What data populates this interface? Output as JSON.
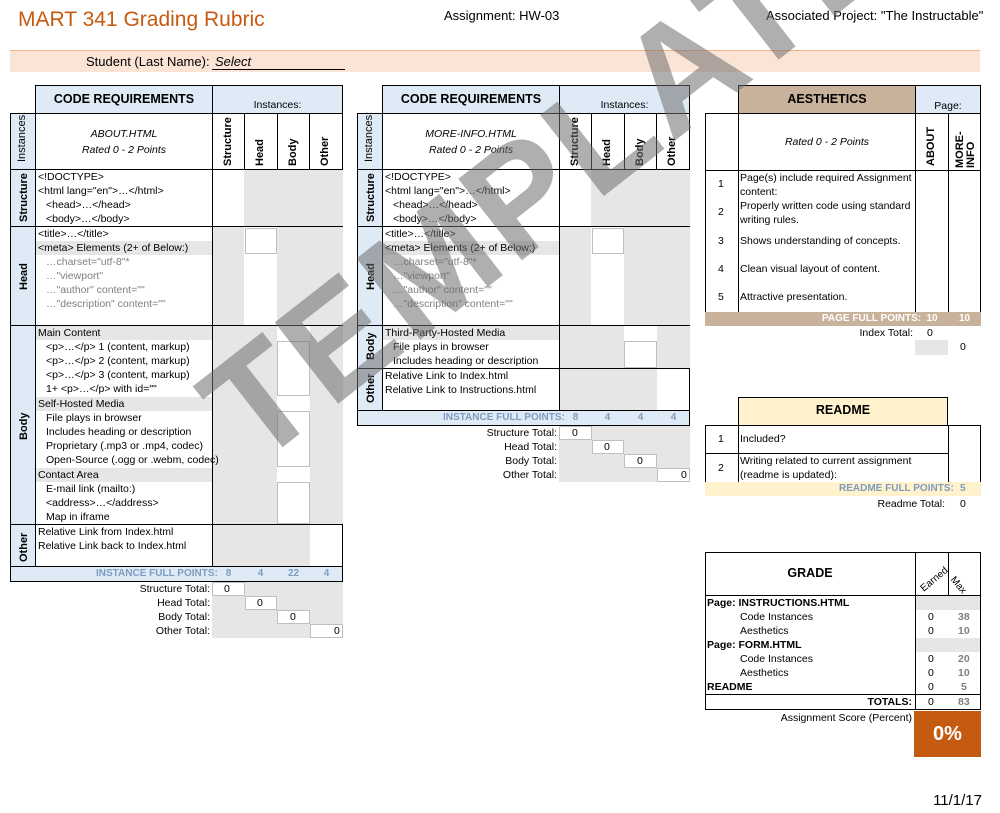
{
  "header": {
    "title": "MART 341 Grading Rubric",
    "assignment": "Assignment: HW-03",
    "project": "Associated Project: \"The Instructable\""
  },
  "student": {
    "label": "Student (Last Name):",
    "value": "Select"
  },
  "watermark": "TEMPLATE",
  "date": "11/1/17",
  "left_table": {
    "heading": "CODE REQUIREMENTS",
    "instances_label": "Instances:",
    "side_label": "Instances:",
    "file": "ABOUT.HTML",
    "rated": "Rated 0 - 2 Points",
    "cols": [
      "Structure",
      "Head",
      "Body",
      "Other"
    ],
    "groups": [
      "Structure",
      "Head",
      "Body",
      "Other"
    ],
    "structure_items": [
      "<!DOCTYPE>",
      "<html lang=\"en\">…</html>",
      "<head>…</head>",
      "<body>…</body>"
    ],
    "head_items": [
      "<title>…</title>",
      "<meta> Elements (2+ of Below:)",
      "…charset=\"utf-8\"*",
      "…\"viewport\"",
      "…\"author\" content=\"\"",
      "…\"description\" content=\"\""
    ],
    "body_items": [
      "Main Content",
      "<p>…</p> 1 (content, markup)",
      "<p>…</p> 2 (content, markup)",
      "<p>…</p> 3 (content, markup)",
      "1+ <p>…</p> with id=\"\"",
      "Self-Hosted Media",
      "File plays in browser",
      "Includes heading or description",
      "Proprietary (.mp3 or .mp4, codec)",
      "Open-Source (.ogg or .webm, codec)",
      "Contact Area",
      "E-mail link (mailto:)",
      "<address>…</address>",
      "Map in iframe"
    ],
    "other_items": [
      "Relative Link from Index.html",
      "Relative Link back to Index.html"
    ],
    "full_points_label": "INSTANCE FULL POINTS:",
    "full_points": [
      "8",
      "4",
      "22",
      "4"
    ],
    "totals": [
      {
        "label": "Structure Total:",
        "value": "0"
      },
      {
        "label": "Head Total:",
        "value": "0"
      },
      {
        "label": "Body Total:",
        "value": "0"
      },
      {
        "label": "Other Total:",
        "value": "0"
      }
    ]
  },
  "mid_table": {
    "heading": "CODE REQUIREMENTS",
    "instances_label": "Instances:",
    "side_label": "Instances:",
    "file": "MORE-INFO.HTML",
    "rated": "Rated 0 - 2 Points",
    "cols": [
      "Structure",
      "Head",
      "Body",
      "Other"
    ],
    "groups": [
      "Structure",
      "Head",
      "Body",
      "Other"
    ],
    "structure_items": [
      "<!DOCTYPE>",
      "<html lang=\"en\">…</html>",
      "<head>…</head>",
      "<body>…</body>"
    ],
    "head_items": [
      "<title>…</title>",
      "<meta> Elements (2+ of Below:)",
      "…charset=\"utf-8\"*",
      "…\"viewport\"",
      "…\"author\" content=\"\"",
      "…\"description\" content=\"\""
    ],
    "body_items": [
      "Third-Party-Hosted Media",
      "File plays in browser",
      "Includes heading or description"
    ],
    "other_items": [
      "Relative Link to Index.html",
      "Relative Link to Instructions.html"
    ],
    "full_points_label": "INSTANCE FULL POINTS:",
    "full_points": [
      "8",
      "4",
      "4",
      "4"
    ],
    "totals": [
      {
        "label": "Structure Total:",
        "value": "0"
      },
      {
        "label": "Head Total:",
        "value": "0"
      },
      {
        "label": "Body Total:",
        "value": "0"
      },
      {
        "label": "Other Total:",
        "value": "0"
      }
    ]
  },
  "aesthetics": {
    "heading": "AESTHETICS",
    "page_label": "Page:",
    "rated": "Rated 0 - 2 Points",
    "cols": [
      "ABOUT",
      "MORE-INFO"
    ],
    "items": [
      {
        "n": "1",
        "text": "Page(s) include required Assignment content:"
      },
      {
        "n": "2",
        "text": "Properly written code using standard writing rules."
      },
      {
        "n": "3",
        "text": "Shows understanding of concepts."
      },
      {
        "n": "4",
        "text": "Clean visual layout of content."
      },
      {
        "n": "5",
        "text": "Attractive presentation."
      }
    ],
    "full_points_label": "PAGE FULL POINTS:",
    "full_points": [
      "10",
      "10"
    ],
    "index_total_label": "Index Total:",
    "index_total": "0",
    "total": "0"
  },
  "readme": {
    "heading": "README",
    "items": [
      {
        "n": "1",
        "text": "Included?"
      },
      {
        "n": "2",
        "text": "Writing related to current assignment (readme is updated):"
      }
    ],
    "full_points_label": "README FULL POINTS:",
    "full_points": "5",
    "total_label": "Readme Total:",
    "total": "0"
  },
  "grade": {
    "heading": "GRADE",
    "col_earned": "Earned",
    "col_max": "Max",
    "rows": [
      {
        "label": "Page: INSTRUCTIONS.HTML",
        "bold": true,
        "earned": "",
        "max": ""
      },
      {
        "label": "Code Instances",
        "bold": false,
        "earned": "0",
        "max": "38"
      },
      {
        "label": "Aesthetics",
        "bold": false,
        "earned": "0",
        "max": "10"
      },
      {
        "label": "Page: FORM.HTML",
        "bold": true,
        "earned": "",
        "max": ""
      },
      {
        "label": "Code Instances",
        "bold": false,
        "earned": "0",
        "max": "20"
      },
      {
        "label": "Aesthetics",
        "bold": false,
        "earned": "0",
        "max": "10"
      },
      {
        "label": "README",
        "bold": true,
        "earned": "0",
        "max": "5"
      }
    ],
    "totals_label": "TOTALS:",
    "totals_earned": "0",
    "totals_max": "83",
    "score_label": "Assignment Score (Percent)",
    "score": "0%"
  }
}
